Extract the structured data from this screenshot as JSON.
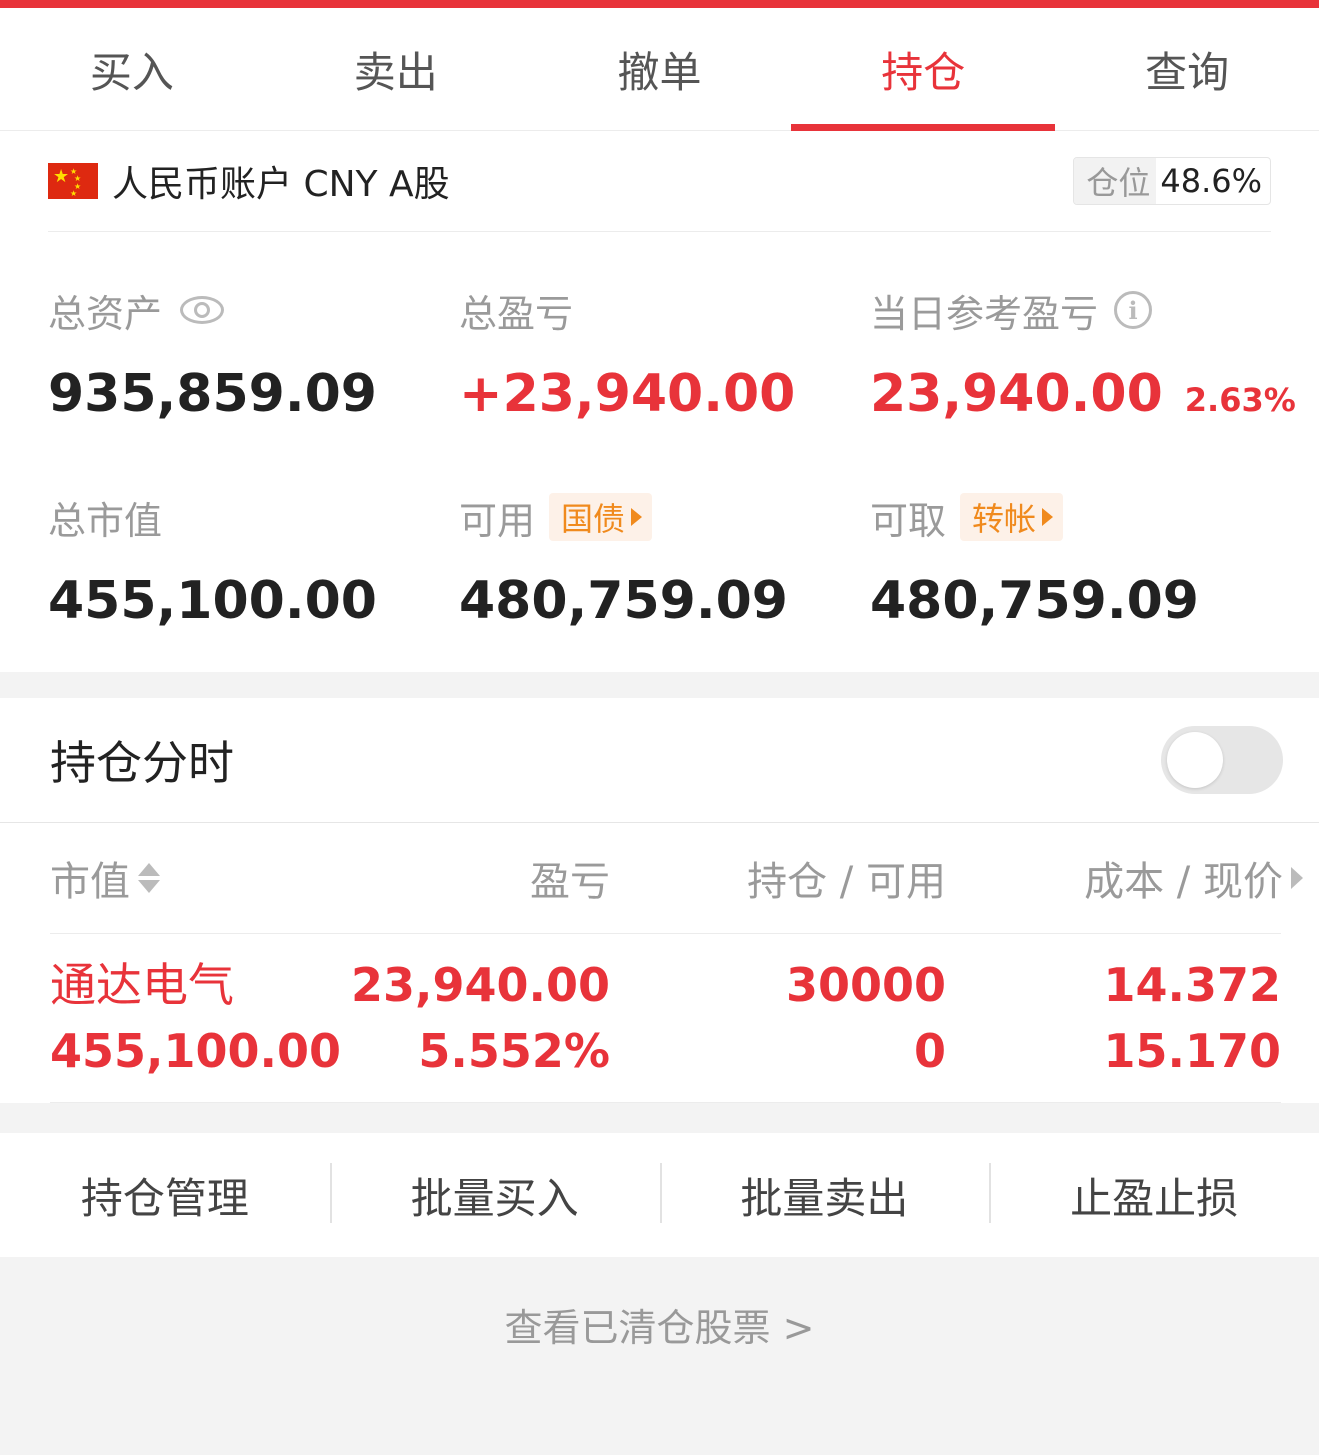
{
  "tabs": [
    {
      "label": "买入"
    },
    {
      "label": "卖出"
    },
    {
      "label": "撤单"
    },
    {
      "label": "持仓"
    },
    {
      "label": "查询"
    }
  ],
  "active_tab": "持仓",
  "account": {
    "name": "人民币账户 CNY A股",
    "position_label": "仓位",
    "position_value": "48.6%"
  },
  "metrics": {
    "total_assets": {
      "label": "总资产",
      "value": "935,859.09"
    },
    "total_pnl": {
      "label": "总盈亏",
      "value": "+23,940.00"
    },
    "daily_pnl": {
      "label": "当日参考盈亏",
      "value": "23,940.00",
      "pct": "2.63%"
    },
    "market_value": {
      "label": "总市值",
      "value": "455,100.00"
    },
    "available": {
      "label": "可用",
      "chip": "国债",
      "value": "480,759.09"
    },
    "withdrawable": {
      "label": "可取",
      "chip": "转帐",
      "value": "480,759.09"
    }
  },
  "holdings": {
    "title": "持仓分时",
    "toggle_on": false,
    "columns": {
      "market_value": "市值",
      "pnl": "盈亏",
      "shares": "持仓 / 可用",
      "cost": "成本 / 现价"
    },
    "rows": [
      {
        "name": "通达电气",
        "market_value": "455,100.00",
        "pnl": "23,940.00",
        "pnl_pct": "5.552%",
        "shares": "30000",
        "available": "0",
        "cost": "14.372",
        "price": "15.170"
      }
    ]
  },
  "actions": [
    {
      "label": "持仓管理"
    },
    {
      "label": "批量买入"
    },
    {
      "label": "批量卖出"
    },
    {
      "label": "止盈止损"
    }
  ],
  "cleared_link": "查看已清仓股票 >",
  "colors": {
    "accent": "#e8333a",
    "chip": "#f08a1d"
  }
}
